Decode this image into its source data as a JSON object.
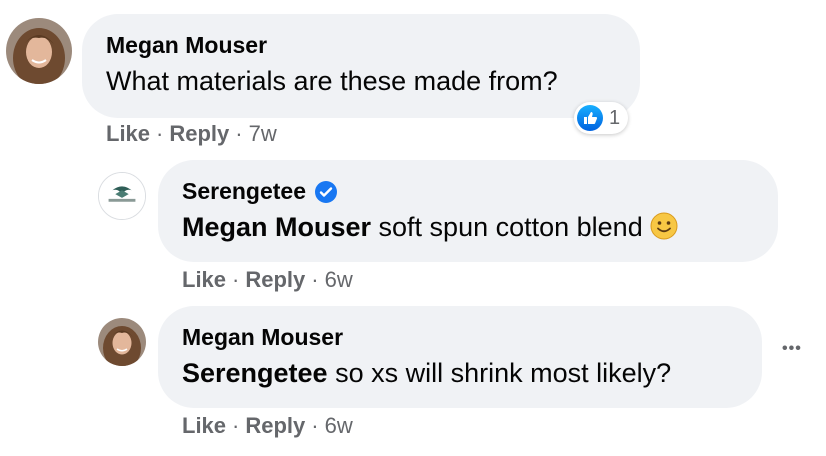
{
  "comments": [
    {
      "author": "Megan Mouser",
      "text": "What materials are these made from?",
      "reaction_count": "1",
      "actions": {
        "like": "Like",
        "reply": "Reply",
        "time": "7w"
      }
    },
    {
      "author": "Serengetee",
      "verified": true,
      "mention": "Megan Mouser",
      "text": " soft spun cotton blend",
      "emoji": "slightly-smiling-face",
      "actions": {
        "like": "Like",
        "reply": "Reply",
        "time": "6w"
      }
    },
    {
      "author": "Megan Mouser",
      "mention": "Serengetee",
      "text": " so xs will shrink most likely?",
      "actions": {
        "like": "Like",
        "reply": "Reply",
        "time": "6w"
      }
    }
  ],
  "more_label": "•••",
  "colors": {
    "bubble": "#f0f2f5",
    "secondary_text": "#65676b",
    "verified_blue": "#1877f2"
  }
}
